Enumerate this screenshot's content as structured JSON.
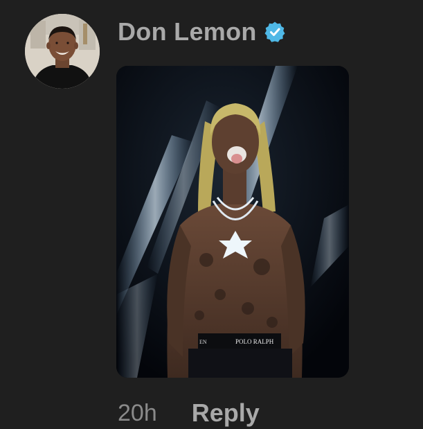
{
  "comment": {
    "username": "Don Lemon",
    "verified_icon": "verified-badge-icon",
    "timestamp": "20h",
    "reply_label": "Reply"
  },
  "media": {
    "waistband_text": "POLO RALPH",
    "waistband_prefix": "EN"
  },
  "colors": {
    "background": "#1f1f1f",
    "text_primary": "#a9a9a9",
    "text_secondary": "#8a8a8a",
    "verified_blue": "#4fb8e6"
  }
}
